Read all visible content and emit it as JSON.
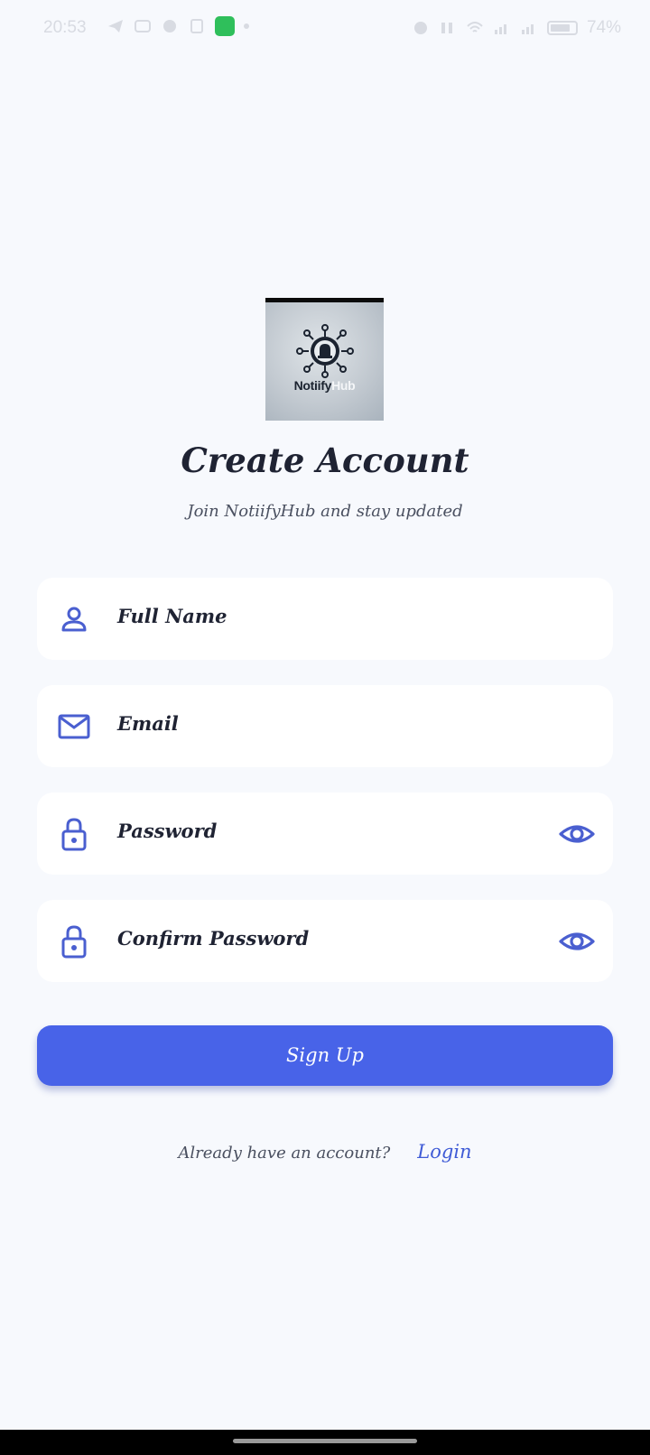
{
  "status_bar": {
    "time": "20:53",
    "battery": "74%"
  },
  "logo": {
    "text_main": "Notiify",
    "text_accent": "Hub"
  },
  "header": {
    "title": "Create Account",
    "subtitle": "Join NotiifyHub and stay updated"
  },
  "form": {
    "full_name_placeholder": "Full Name",
    "email_placeholder": "Email",
    "password_placeholder": "Password",
    "confirm_password_placeholder": "Confirm Password",
    "signup_label": "Sign Up"
  },
  "footer": {
    "prompt": "Already have an account?",
    "login_label": "Login"
  },
  "colors": {
    "accent": "#4863e8",
    "icon": "#4a5fd0",
    "background": "#f7f9fd"
  }
}
